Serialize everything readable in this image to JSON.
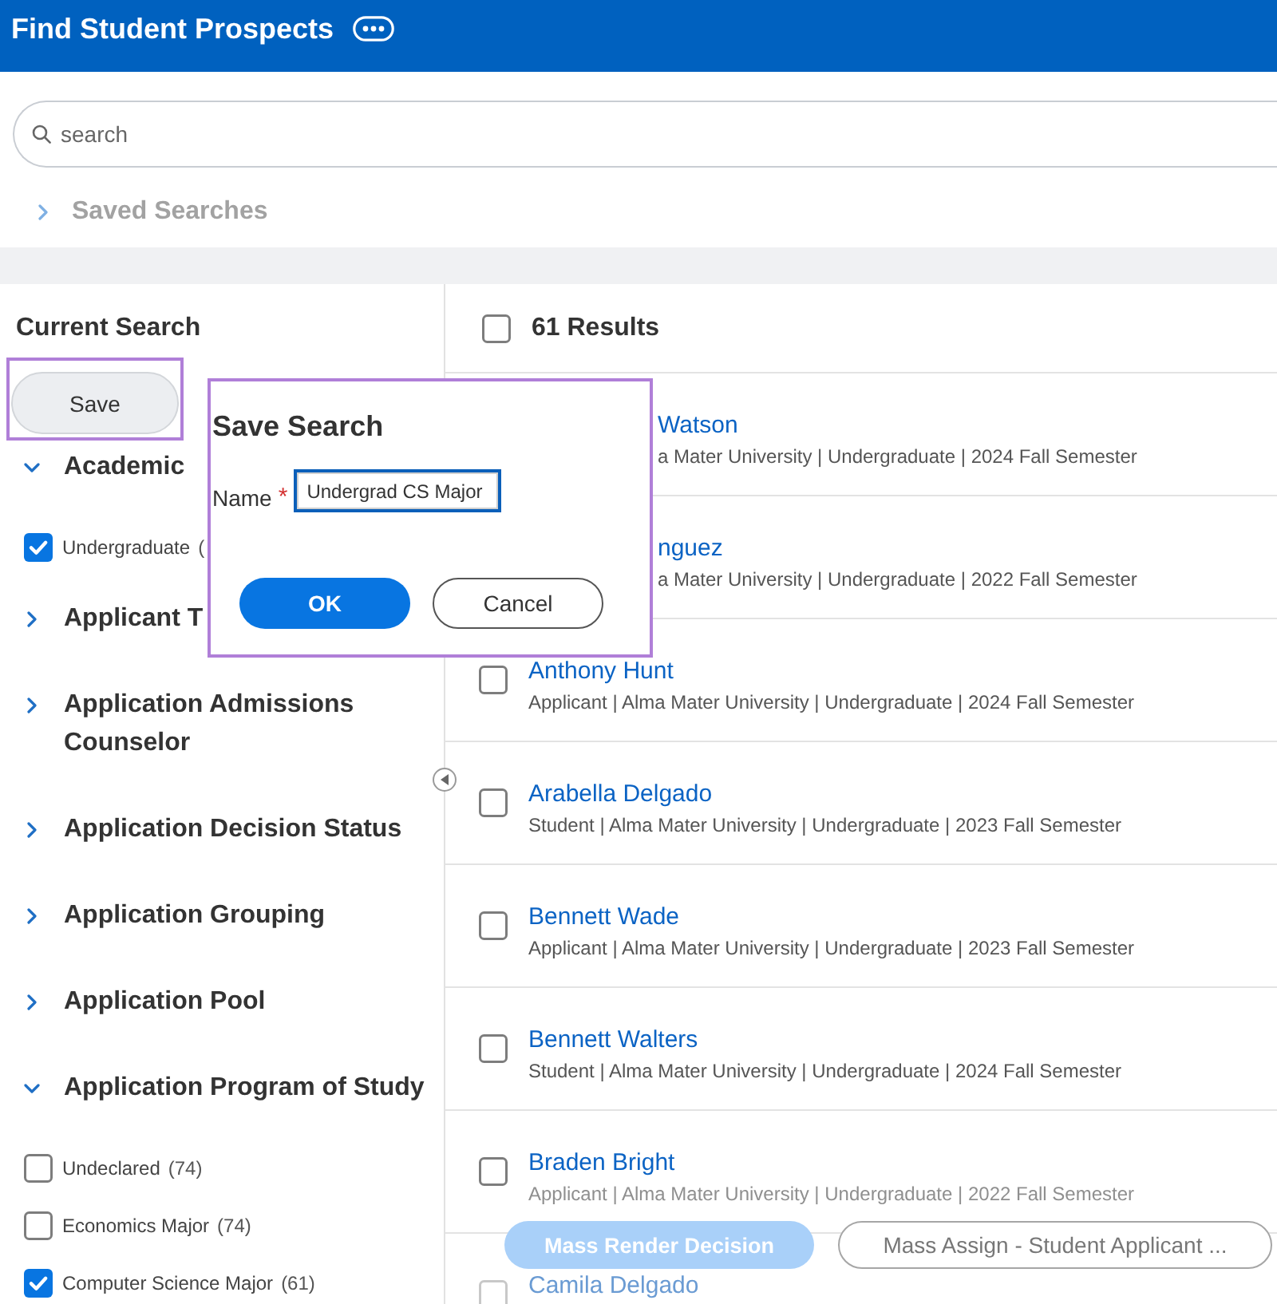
{
  "header": {
    "title": "Find Student Prospects"
  },
  "search": {
    "placeholder": "search"
  },
  "saved_searches": {
    "label": "Saved Searches",
    "expanded": false,
    "disabled": true
  },
  "current_search": {
    "title": "Current Search",
    "save_button": {
      "label": "Save",
      "highlighted": true
    }
  },
  "filters": [
    {
      "label": "Academic",
      "expanded": true,
      "options": [
        {
          "label": "Undergraduate",
          "count": "(",
          "checked": true
        }
      ]
    },
    {
      "label": "Applicant T",
      "expanded": false
    },
    {
      "label": "Application Admissions Counselor",
      "expanded": false
    },
    {
      "label": "Application Decision Status",
      "expanded": false
    },
    {
      "label": "Application Grouping",
      "expanded": false
    },
    {
      "label": "Application Pool",
      "expanded": false
    },
    {
      "label": "Application Program of Study",
      "expanded": true,
      "options": [
        {
          "label": "Undeclared",
          "count": "(74)",
          "checked": false
        },
        {
          "label": "Economics Major",
          "count": "(74)",
          "checked": false
        },
        {
          "label": "Computer Science Major",
          "count": "(61)",
          "checked": true
        }
      ]
    }
  ],
  "results": {
    "title": "61 Results",
    "select_all": {
      "checked": false
    },
    "rows": [
      {
        "kind": "covered",
        "name": "Watson",
        "details": "a Mater University | Undergraduate | 2024 Fall Semester"
      },
      {
        "kind": "covered",
        "name": "nguez",
        "details": "a Mater University | Undergraduate | 2022 Fall Semester"
      },
      {
        "kind": "plain",
        "checked": false,
        "name": "Anthony Hunt",
        "details": "Applicant | Alma Mater University | Undergraduate | 2024 Fall Semester"
      },
      {
        "kind": "plain",
        "checked": false,
        "name": "Arabella Delgado",
        "details": "Student | Alma Mater University | Undergraduate | 2023 Fall Semester"
      },
      {
        "kind": "plain",
        "checked": false,
        "name": "Bennett Wade",
        "details": "Applicant | Alma Mater University | Undergraduate | 2023 Fall Semester"
      },
      {
        "kind": "plain",
        "checked": false,
        "name": "Bennett Walters",
        "details": "Student | Alma Mater University | Undergraduate | 2024 Fall Semester"
      },
      {
        "kind": "edge",
        "checked": false,
        "name": "Braden Bright",
        "details": "Applicant | Alma Mater University | Undergraduate | 2022 Fall Semester"
      },
      {
        "kind": "faded",
        "checked": false,
        "name": "Camila Delgado"
      }
    ]
  },
  "actions": [
    {
      "kind": "primary",
      "label": "Mass Render Decision",
      "disabled": true
    },
    {
      "kind": "secondary",
      "label": "Mass Assign - Student Applicant ...",
      "disabled": true
    }
  ],
  "dialog": {
    "title": "Save Search",
    "highlighted": true,
    "field": {
      "label": "Name",
      "required_mark": "*",
      "value": "Undergrad CS Major",
      "focused": true
    },
    "buttons": [
      {
        "kind": "primary",
        "label": "OK"
      },
      {
        "kind": "secondary",
        "label": "Cancel"
      }
    ]
  }
}
